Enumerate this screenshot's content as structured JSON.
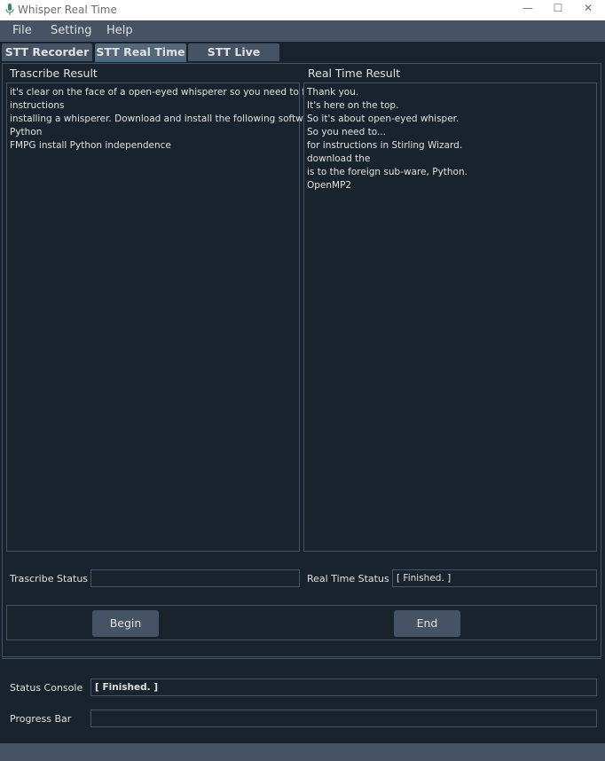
{
  "window": {
    "title": "Whisper Real Time",
    "minimize": "—",
    "maximize": "☐",
    "close": "✕"
  },
  "menu": [
    "File",
    "Setting",
    "Help"
  ],
  "tabs": [
    "STT Recorder",
    "STT Real Time",
    "STT Live"
  ],
  "selected_tab": "STT Real Time",
  "transcribe": {
    "heading": "Trascribe  Result",
    "lines": [
      "it's clear on the face of a open-eyed whisperer so you need to follow",
      "instructions",
      "installing a whisperer. Download and install the following software",
      "Python",
      "FMPG install Python independence"
    ],
    "status_label": "Trascribe Status",
    "status_value": ""
  },
  "realtime": {
    "heading": "Real Time Result",
    "lines": [
      "Thank you.",
      "It's here on the top.",
      "So it's about open-eyed whisper.",
      "So you need to...",
      "for instructions in Stirling Wizard.",
      "download the",
      "is to the foreign sub-ware, Python.",
      "OpenMP2"
    ],
    "status_label": "Real Time Status",
    "status_value": "[ Finished. ]"
  },
  "buttons": {
    "begin": "Begin",
    "end": "End"
  },
  "console": {
    "label": "Status Console",
    "value": "[ Finished. ]",
    "progress_label": "Progress Bar",
    "progress": 0
  },
  "colors": {
    "background": "#19232d",
    "panel": "#455364",
    "accent": "#346792",
    "text": "#e0e1e3"
  }
}
